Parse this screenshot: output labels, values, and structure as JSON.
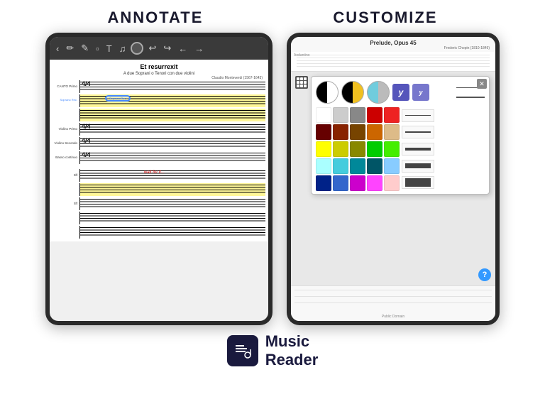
{
  "header": {
    "annotate_label": "ANNOTATE",
    "customize_label": "CUSTOMIZE"
  },
  "annotate_tablet": {
    "score_title": "Et resurrexit",
    "score_subtitle": "A due Soprani o Tenori con due violini",
    "composer": "Claudio Monteverdi (1567-1643)",
    "parts": [
      {
        "label": "CANTO Primo",
        "has_highlight": false
      },
      {
        "label": "Soprano Rec.",
        "has_highlight": true
      },
      {
        "label": "",
        "has_highlight": true
      },
      {
        "label": "Violino Primo",
        "has_highlight": false
      },
      {
        "label": "Violino Secondo",
        "has_highlight": false
      },
      {
        "label": "Basso continuo",
        "has_highlight": false
      }
    ],
    "wait_text": "wait for it..."
  },
  "customize_tablet": {
    "score_title": "Prelude, Opus 45",
    "composer": "Frederic Chopin (1810-1849)",
    "subtitle": "Andantino",
    "color_picker": {
      "close_label": "✕",
      "top_circles": [
        {
          "type": "half-black-white"
        },
        {
          "type": "half-yellow"
        },
        {
          "type": "half-cyan-gray"
        }
      ],
      "y_buttons": [
        {
          "label": "y",
          "color": "#5555bb"
        },
        {
          "label": "y",
          "color": "#7777cc"
        }
      ],
      "colors_grid": [
        [
          "#ffffff",
          "#dddddd",
          "#888888",
          "#444444",
          "#000000"
        ],
        [
          "#ffcccc",
          "#ff6666",
          "#cc0000",
          "#880000",
          "#440000"
        ],
        [
          "#ffddcc",
          "#ff9966",
          "#cc5500",
          "#884400",
          "#ccaa77"
        ],
        [
          "#ffff99",
          "#ffcc00",
          "#cc8800",
          "#887700",
          "#ffffcc"
        ],
        [
          "#ccffcc",
          "#66cc33",
          "#228800",
          "#004400",
          "#99ff00"
        ],
        [
          "#ccffff",
          "#44ccdd",
          "#008899",
          "#004455",
          "#aaddff"
        ]
      ],
      "line_thicknesses": [
        1,
        2,
        4,
        8,
        16
      ]
    },
    "preview_label": "Public Domain"
  },
  "footer": {
    "app_name_line1": "Music",
    "app_name_line2": "Reader",
    "icon_symbol": "🎵"
  }
}
